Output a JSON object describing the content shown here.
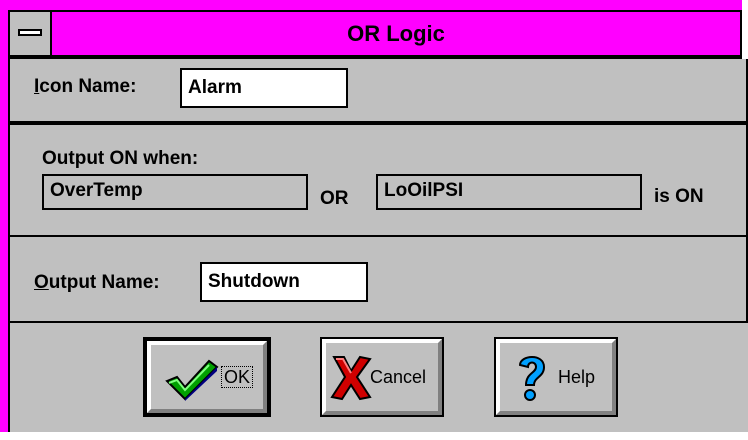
{
  "window": {
    "title": "OR Logic"
  },
  "icon_name": {
    "label_prefix": "I",
    "label_rest": "con Name:",
    "value": "Alarm"
  },
  "output_on": {
    "heading": "Output ON when:",
    "input1": "OverTemp",
    "operator": "OR",
    "input2": "LoOilPSI",
    "suffix": "is ON"
  },
  "output_name": {
    "label_prefix": "O",
    "label_rest": "utput Name:",
    "value": "Shutdown"
  },
  "buttons": {
    "ok_label": "OK",
    "cancel_label": "Cancel",
    "help_label": "Help"
  },
  "icons": {
    "ok": "checkmark-icon",
    "cancel": "x-icon",
    "help": "question-icon"
  },
  "colors": {
    "title_bar": "#ff00ff",
    "face": "#c0c0c0"
  }
}
